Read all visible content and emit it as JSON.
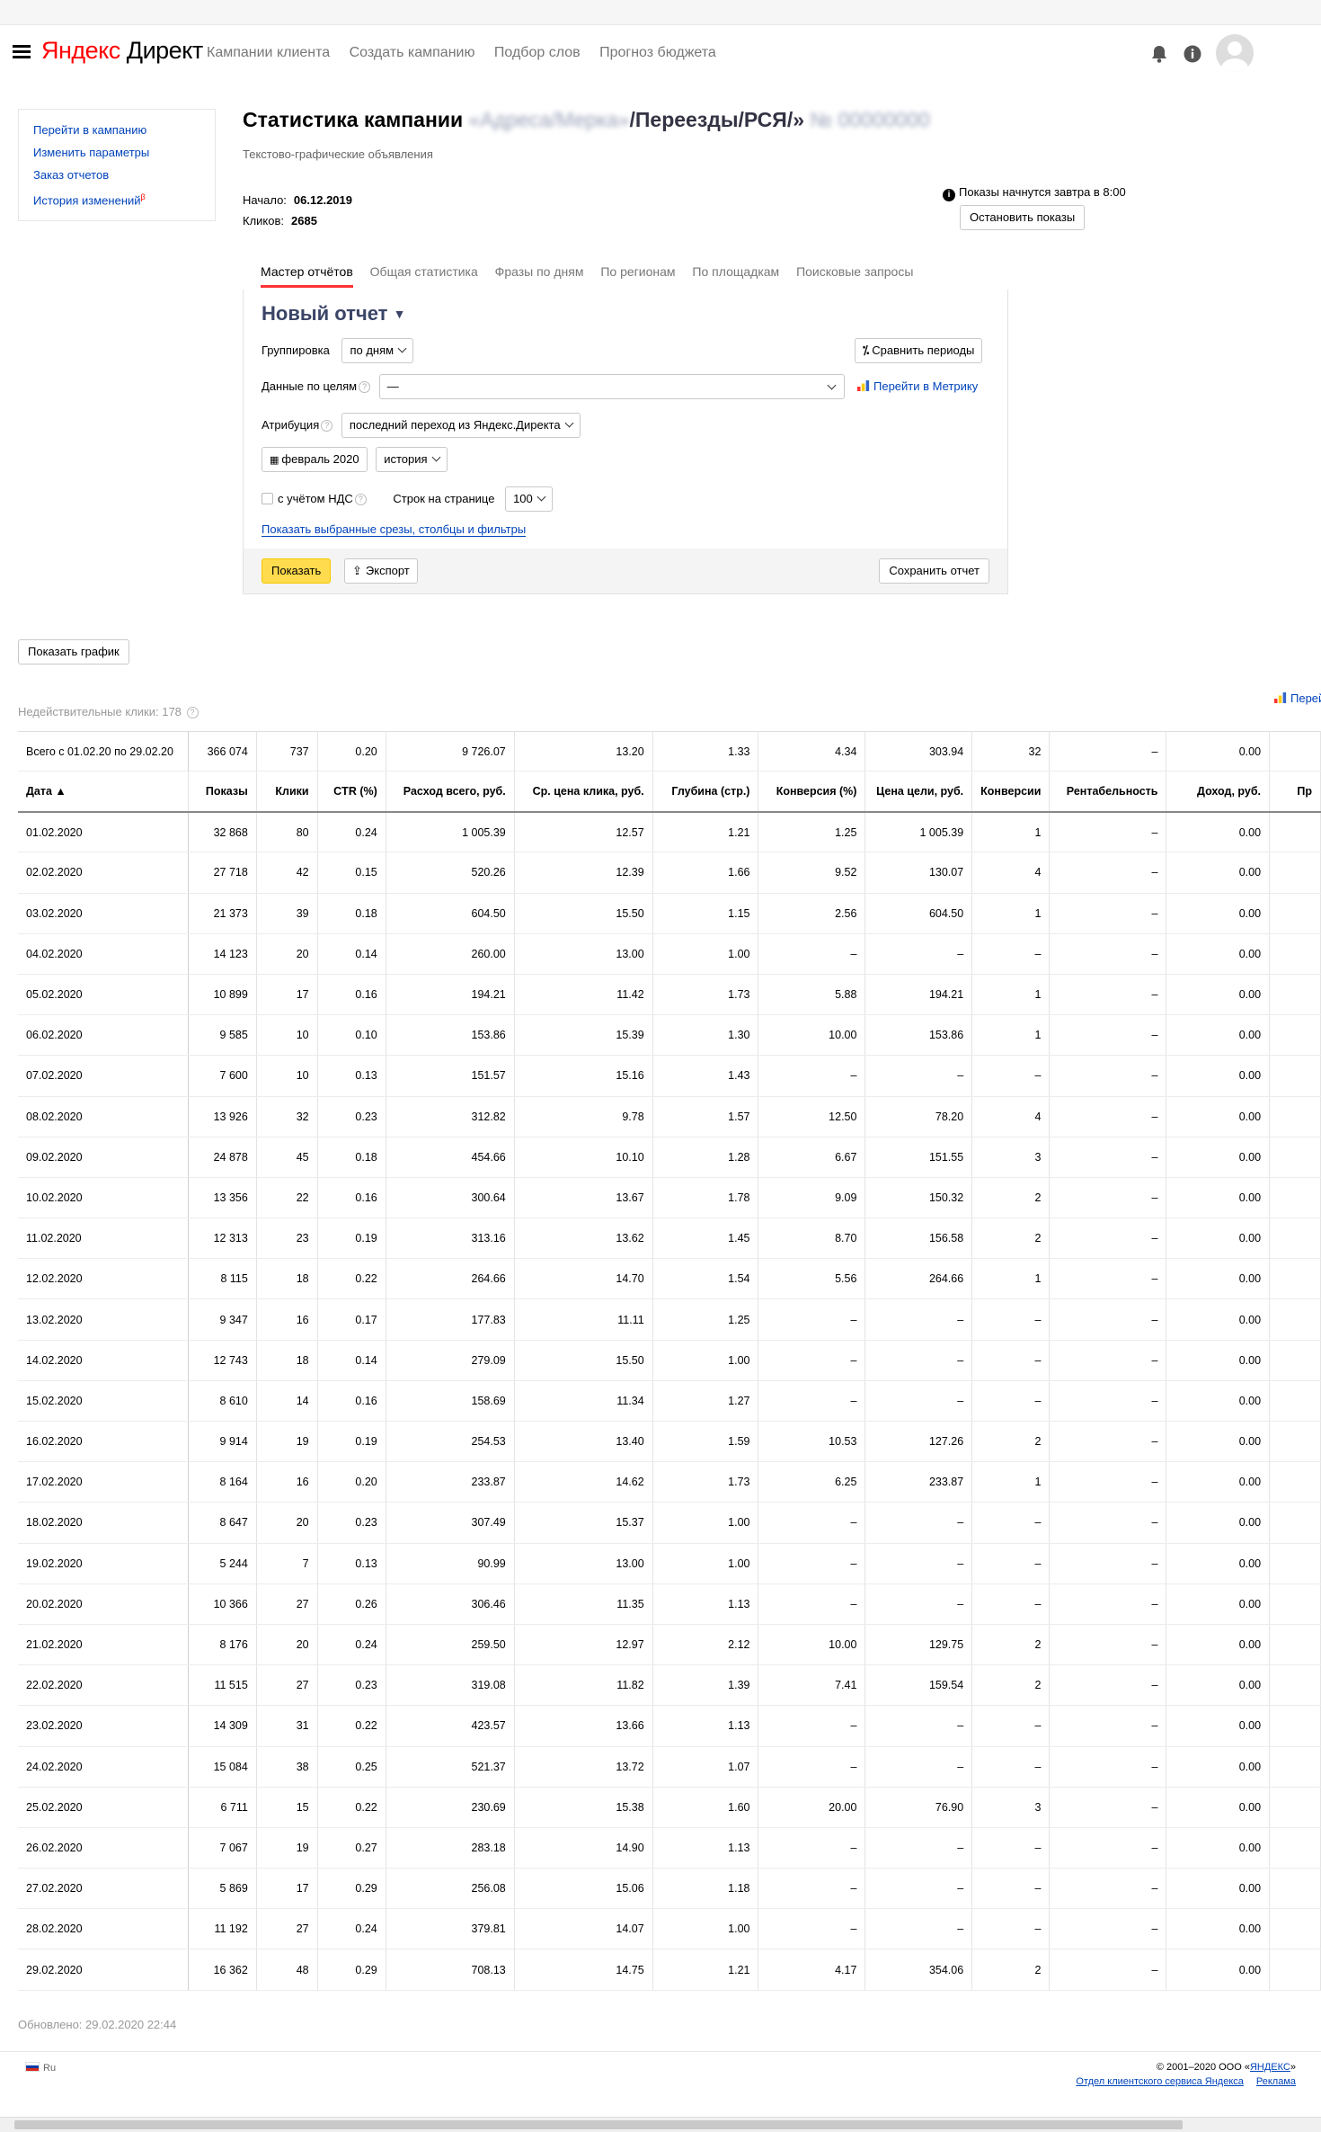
{
  "header": {
    "logo_ya": "Яндекс",
    "logo_rest": " Директ",
    "nav": [
      "Кампании клиента",
      "Создать кампанию",
      "Подбор слов",
      "Прогноз бюджета"
    ]
  },
  "leftmenu": {
    "items": [
      "Перейти в кампанию",
      "Изменить параметры",
      "Заказ отчетов",
      "История изменений"
    ],
    "history_badge": "β"
  },
  "page": {
    "title_prefix": "Статистика кампании",
    "title_hidden": "«Адреса/Мерка»",
    "title_path": "/Переезды/РСЯ/»",
    "title_id": "№ 00000000",
    "subtitle": "Текстово-графические объявления",
    "start_label": "Начало:",
    "start_value": "06.12.2019",
    "clicks_label": "Кликов:",
    "clicks_value": "2685",
    "notice": "Показы начнутся завтра в 8:00",
    "stop_button": "Остановить показы"
  },
  "tabs": [
    "Мастер отчётов",
    "Общая статистика",
    "Фразы по дням",
    "По регионам",
    "По площадкам",
    "Поисковые запросы"
  ],
  "report": {
    "title": "Новый отчет",
    "grouping_label": "Группировка",
    "grouping_value": "по дням",
    "compare_button": "Сравнить периоды",
    "goals_label": "Данные по целям",
    "goals_value": "—",
    "metrika_link": "Перейти в Метрику",
    "attribution_label": "Атрибуция",
    "attribution_value": "последний переход из Яндекс.Директа",
    "period_value": "февраль 2020",
    "history_value": "история",
    "vat_label": "с учётом НДС",
    "rows_label": "Строк на странице",
    "rows_value": "100",
    "slices_link": "Показать выбранные срезы, столбцы и фильтры",
    "show_button": "Показать",
    "export_button": "Экспорт",
    "save_button": "Сохранить отчет"
  },
  "show_graph_button": "Показать график",
  "invalid_clicks": "Недействительные клики: 178",
  "pereiti_partial": "Перей",
  "table": {
    "totals": [
      "Всего с 01.02.20 по 29.02.20",
      "366 074",
      "737",
      "0.20",
      "9 726.07",
      "13.20",
      "1.33",
      "4.34",
      "303.94",
      "32",
      "–",
      "0.00",
      ""
    ],
    "columns": [
      "Дата ▲",
      "Показы",
      "Клики",
      "CTR (%)",
      "Расход всего, руб.",
      "Ср. цена клика, руб.",
      "Глубина (стр.)",
      "Конверсия (%)",
      "Цена цели, руб.",
      "Конверсии",
      "Рентабельность",
      "Доход, руб.",
      "Пр"
    ],
    "rows": [
      [
        "01.02.2020",
        "32 868",
        "80",
        "0.24",
        "1 005.39",
        "12.57",
        "1.21",
        "1.25",
        "1 005.39",
        "1",
        "–",
        "0.00",
        ""
      ],
      [
        "02.02.2020",
        "27 718",
        "42",
        "0.15",
        "520.26",
        "12.39",
        "1.66",
        "9.52",
        "130.07",
        "4",
        "–",
        "0.00",
        ""
      ],
      [
        "03.02.2020",
        "21 373",
        "39",
        "0.18",
        "604.50",
        "15.50",
        "1.15",
        "2.56",
        "604.50",
        "1",
        "–",
        "0.00",
        ""
      ],
      [
        "04.02.2020",
        "14 123",
        "20",
        "0.14",
        "260.00",
        "13.00",
        "1.00",
        "–",
        "–",
        "–",
        "–",
        "0.00",
        ""
      ],
      [
        "05.02.2020",
        "10 899",
        "17",
        "0.16",
        "194.21",
        "11.42",
        "1.73",
        "5.88",
        "194.21",
        "1",
        "–",
        "0.00",
        ""
      ],
      [
        "06.02.2020",
        "9 585",
        "10",
        "0.10",
        "153.86",
        "15.39",
        "1.30",
        "10.00",
        "153.86",
        "1",
        "–",
        "0.00",
        ""
      ],
      [
        "07.02.2020",
        "7 600",
        "10",
        "0.13",
        "151.57",
        "15.16",
        "1.43",
        "–",
        "–",
        "–",
        "–",
        "0.00",
        ""
      ],
      [
        "08.02.2020",
        "13 926",
        "32",
        "0.23",
        "312.82",
        "9.78",
        "1.57",
        "12.50",
        "78.20",
        "4",
        "–",
        "0.00",
        ""
      ],
      [
        "09.02.2020",
        "24 878",
        "45",
        "0.18",
        "454.66",
        "10.10",
        "1.28",
        "6.67",
        "151.55",
        "3",
        "–",
        "0.00",
        ""
      ],
      [
        "10.02.2020",
        "13 356",
        "22",
        "0.16",
        "300.64",
        "13.67",
        "1.78",
        "9.09",
        "150.32",
        "2",
        "–",
        "0.00",
        ""
      ],
      [
        "11.02.2020",
        "12 313",
        "23",
        "0.19",
        "313.16",
        "13.62",
        "1.45",
        "8.70",
        "156.58",
        "2",
        "–",
        "0.00",
        ""
      ],
      [
        "12.02.2020",
        "8 115",
        "18",
        "0.22",
        "264.66",
        "14.70",
        "1.54",
        "5.56",
        "264.66",
        "1",
        "–",
        "0.00",
        ""
      ],
      [
        "13.02.2020",
        "9 347",
        "16",
        "0.17",
        "177.83",
        "11.11",
        "1.25",
        "–",
        "–",
        "–",
        "–",
        "0.00",
        ""
      ],
      [
        "14.02.2020",
        "12 743",
        "18",
        "0.14",
        "279.09",
        "15.50",
        "1.00",
        "–",
        "–",
        "–",
        "–",
        "0.00",
        ""
      ],
      [
        "15.02.2020",
        "8 610",
        "14",
        "0.16",
        "158.69",
        "11.34",
        "1.27",
        "–",
        "–",
        "–",
        "–",
        "0.00",
        ""
      ],
      [
        "16.02.2020",
        "9 914",
        "19",
        "0.19",
        "254.53",
        "13.40",
        "1.59",
        "10.53",
        "127.26",
        "2",
        "–",
        "0.00",
        ""
      ],
      [
        "17.02.2020",
        "8 164",
        "16",
        "0.20",
        "233.87",
        "14.62",
        "1.73",
        "6.25",
        "233.87",
        "1",
        "–",
        "0.00",
        ""
      ],
      [
        "18.02.2020",
        "8 647",
        "20",
        "0.23",
        "307.49",
        "15.37",
        "1.00",
        "–",
        "–",
        "–",
        "–",
        "0.00",
        ""
      ],
      [
        "19.02.2020",
        "5 244",
        "7",
        "0.13",
        "90.99",
        "13.00",
        "1.00",
        "–",
        "–",
        "–",
        "–",
        "0.00",
        ""
      ],
      [
        "20.02.2020",
        "10 366",
        "27",
        "0.26",
        "306.46",
        "11.35",
        "1.13",
        "–",
        "–",
        "–",
        "–",
        "0.00",
        ""
      ],
      [
        "21.02.2020",
        "8 176",
        "20",
        "0.24",
        "259.50",
        "12.97",
        "2.12",
        "10.00",
        "129.75",
        "2",
        "–",
        "0.00",
        ""
      ],
      [
        "22.02.2020",
        "11 515",
        "27",
        "0.23",
        "319.08",
        "11.82",
        "1.39",
        "7.41",
        "159.54",
        "2",
        "–",
        "0.00",
        ""
      ],
      [
        "23.02.2020",
        "14 309",
        "31",
        "0.22",
        "423.57",
        "13.66",
        "1.13",
        "–",
        "–",
        "–",
        "–",
        "0.00",
        ""
      ],
      [
        "24.02.2020",
        "15 084",
        "38",
        "0.25",
        "521.37",
        "13.72",
        "1.07",
        "–",
        "–",
        "–",
        "–",
        "0.00",
        ""
      ],
      [
        "25.02.2020",
        "6 711",
        "15",
        "0.22",
        "230.69",
        "15.38",
        "1.60",
        "20.00",
        "76.90",
        "3",
        "–",
        "0.00",
        ""
      ],
      [
        "26.02.2020",
        "7 067",
        "19",
        "0.27",
        "283.18",
        "14.90",
        "1.13",
        "–",
        "–",
        "–",
        "–",
        "0.00",
        ""
      ],
      [
        "27.02.2020",
        "5 869",
        "17",
        "0.29",
        "256.08",
        "15.06",
        "1.18",
        "–",
        "–",
        "–",
        "–",
        "0.00",
        ""
      ],
      [
        "28.02.2020",
        "11 192",
        "27",
        "0.24",
        "379.81",
        "14.07",
        "1.00",
        "–",
        "–",
        "–",
        "–",
        "0.00",
        ""
      ],
      [
        "29.02.2020",
        "16 362",
        "48",
        "0.29",
        "708.13",
        "14.75",
        "1.21",
        "4.17",
        "354.06",
        "2",
        "–",
        "0.00",
        ""
      ]
    ]
  },
  "updated": "Обновлено: 29.02.2020 22:44",
  "footer": {
    "lang": "Ru",
    "copyright_prefix": "© 2001–2020 ООО «",
    "copyright_link": "ЯНДЕКС",
    "copyright_suffix": "»",
    "support_link": "Отдел клиентского сервиса Яндекса",
    "ads_link": "Реклама"
  },
  "colors": {
    "accent_link": "#0044bb",
    "tab_active": "#ff3333",
    "primary_button": "#ffdb4d",
    "logo_red": "#ff0000"
  }
}
